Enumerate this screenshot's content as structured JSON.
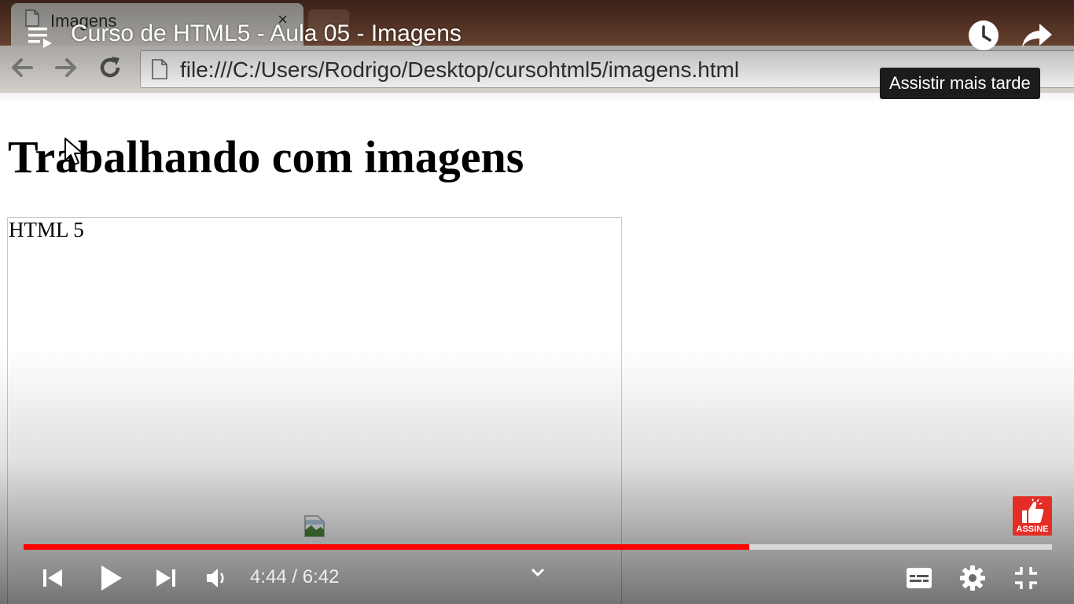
{
  "browser": {
    "tab_title": "Imagens",
    "tab_close": "×",
    "url": "file:///C:/Users/Rodrigo/Desktop/cursohtml5/imagens.html"
  },
  "page": {
    "heading": "Trabalhando com imagens",
    "image_alt": "HTML 5"
  },
  "player": {
    "title": "Curso de HTML5 - Aula 05 - Imagens",
    "tooltip": "Assistir mais tarde",
    "subscribe_label": "ASSINE",
    "time_display": "4:44 / 6:42",
    "progress_fraction": 0.706,
    "accent_color": "#ff0000"
  },
  "icons": {
    "playlist": "playlist-icon",
    "watch_later": "clock-icon",
    "share": "share-arrow-icon",
    "prev": "skip-previous-icon",
    "play": "play-icon",
    "next": "skip-next-icon",
    "volume": "volume-icon",
    "chevron": "chevron-down-icon",
    "subtitles": "subtitles-icon",
    "settings": "gear-icon",
    "exit_fullscreen": "exit-fullscreen-icon",
    "subscribe": "thumbs-up-icon"
  }
}
